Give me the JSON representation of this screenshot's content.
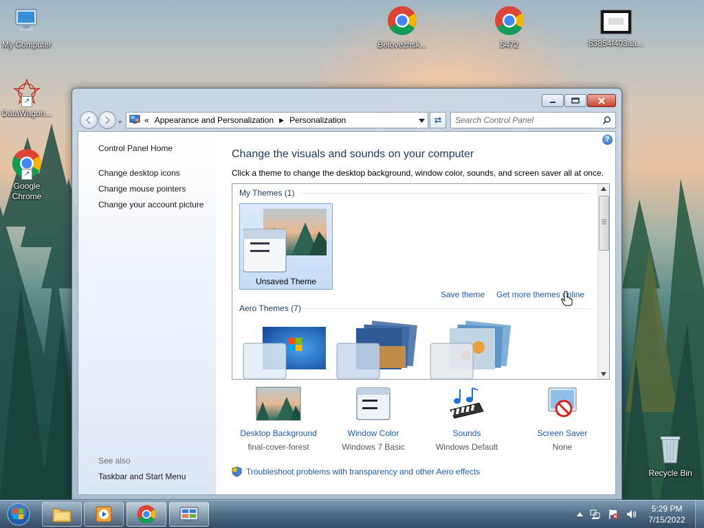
{
  "desktop": {
    "icons": [
      {
        "id": "my-computer",
        "label": "My Computer"
      },
      {
        "id": "datawagon",
        "label": "DataWagon..."
      },
      {
        "id": "google-chrome",
        "label": "Google\nChrome"
      },
      {
        "id": "belovezhsk",
        "label": "Belovezhsk..."
      },
      {
        "id": "5472",
        "label": "5472"
      },
      {
        "id": "83854f403aa",
        "label": "83854f403aa..."
      },
      {
        "id": "recycle-bin",
        "label": "Recycle Bin"
      }
    ]
  },
  "window": {
    "address": {
      "chevron": "«",
      "crumbs": [
        "Appearance and Personalization",
        "Personalization"
      ]
    },
    "search_placeholder": "Search Control Panel",
    "left_pane": {
      "home": "Control Panel Home",
      "links": [
        "Change desktop icons",
        "Change mouse pointers",
        "Change your account picture"
      ],
      "see_also": "See also",
      "see_also_links": [
        "Taskbar and Start Menu"
      ]
    },
    "heading": "Change the visuals and sounds on your computer",
    "subheading": "Click a theme to change the desktop background, window color, sounds, and screen saver all at once.",
    "my_themes": {
      "label": "My Themes (1)",
      "items": [
        {
          "name": "Unsaved Theme",
          "selected": true
        }
      ],
      "save_link": "Save theme",
      "more_link": "Get more themes online"
    },
    "aero_themes": {
      "label": "Aero Themes (7)"
    },
    "settings": [
      {
        "title": "Desktop Background",
        "value": "final-cover-forest",
        "icon": "desktop-background-icon"
      },
      {
        "title": "Window Color",
        "value": "Windows 7 Basic",
        "icon": "window-color-icon"
      },
      {
        "title": "Sounds",
        "value": "Windows Default",
        "icon": "sounds-icon"
      },
      {
        "title": "Screen Saver",
        "value": "None",
        "icon": "screen-saver-icon"
      }
    ],
    "troubleshoot": "Troubleshoot problems with transparency and other Aero effects"
  },
  "taskbar": {
    "time": "5:29 PM",
    "date": "7/15/2022"
  },
  "colors": {
    "link": "#1e5aa8",
    "heading": "#1e395b"
  }
}
